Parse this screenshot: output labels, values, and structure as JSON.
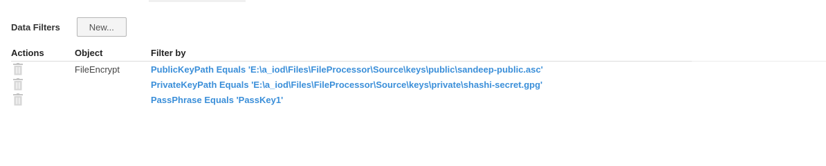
{
  "data_filters": {
    "title": "Data Filters",
    "new_button_label": "New..."
  },
  "table": {
    "headers": {
      "actions": "Actions",
      "object": "Object",
      "filter_by": "Filter by"
    },
    "rows": [
      {
        "action_icon": "trash-icon",
        "object": "FileEncrypt",
        "filter": "PublicKeyPath Equals 'E:\\a_iod\\Files\\FileProcessor\\Source\\keys\\public\\sandeep-public.asc'"
      },
      {
        "action_icon": "trash-icon",
        "object": "",
        "filter": "PrivateKeyPath Equals 'E:\\a_iod\\Files\\FileProcessor\\Source\\keys\\private\\shashi-secret.gpg'"
      },
      {
        "action_icon": "trash-icon",
        "object": "",
        "filter": "PassPhrase Equals 'PassKey1'"
      }
    ]
  },
  "colors": {
    "link": "#3b8fd9",
    "icon": "#b8b8b8",
    "border": "#dcdcdc"
  }
}
